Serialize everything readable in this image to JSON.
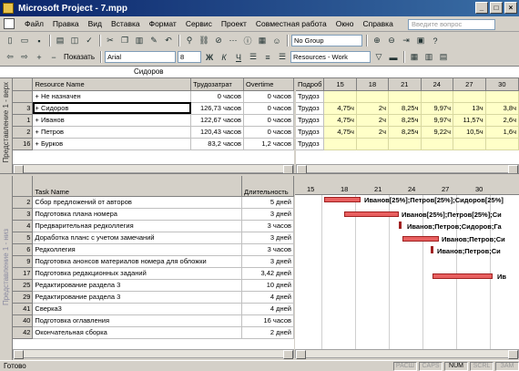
{
  "window": {
    "title": "Microsoft Project - 7.mpp"
  },
  "menu": [
    "Файл",
    "Правка",
    "Вид",
    "Вставка",
    "Формат",
    "Сервис",
    "Проект",
    "Совместная работа",
    "Окно",
    "Справка"
  ],
  "help_placeholder": "Введите вопрос",
  "toolbar": {
    "group": "No Group",
    "show": "Показать",
    "font": "Arial",
    "font_size": "8",
    "bold": "Ж",
    "italic": "К",
    "underline": "Ч",
    "filter": "Resources - Work"
  },
  "entry_bar": {
    "value": "Сидоров"
  },
  "top_view": {
    "side_label": "Представление 1 - верх",
    "columns": [
      "Resource Name",
      "Трудозатрат",
      "Overtime"
    ],
    "rows": [
      {
        "id": "",
        "name": "Не назначен",
        "work": "0 часов",
        "ot": "0 часов"
      },
      {
        "id": "3",
        "name": "Сидоров",
        "work": "126,73 часов",
        "ot": "0 часов"
      },
      {
        "id": "1",
        "name": "Иванов",
        "work": "122,67 часов",
        "ot": "0 часов"
      },
      {
        "id": "2",
        "name": "Петров",
        "work": "120,43 часов",
        "ot": "0 часов"
      },
      {
        "id": "16",
        "name": "Бурков",
        "work": "83,2 часов",
        "ot": "1,2 часов"
      }
    ]
  },
  "timescale": {
    "detail_header": "Подроб",
    "dates": [
      "15",
      "18",
      "21",
      "24",
      "27",
      "30"
    ],
    "label": "Трудоз",
    "rows": [
      [
        "",
        "",
        "",
        "",
        "",
        ""
      ],
      [
        "4,75ч",
        "2ч",
        "8,25ч",
        "9,97ч",
        "13ч",
        "3,8ч"
      ],
      [
        "4,75ч",
        "2ч",
        "8,25ч",
        "9,97ч",
        "11,57ч",
        "2,6ч"
      ],
      [
        "4,75ч",
        "2ч",
        "8,25ч",
        "9,22ч",
        "10,5ч",
        "1,6ч"
      ],
      [
        "",
        "",
        "",
        "",
        "",
        ""
      ]
    ]
  },
  "bottom_view": {
    "side_label": "Представление 1 - низ",
    "columns": [
      "Task Name",
      "Длительность"
    ],
    "rows": [
      {
        "id": "2",
        "name": "Сбор предложений от авторов",
        "dur": "5 дней"
      },
      {
        "id": "3",
        "name": "Подготовка плана номера",
        "dur": "3 дней"
      },
      {
        "id": "4",
        "name": "Предварительная редколлегия",
        "dur": "3 часов"
      },
      {
        "id": "5",
        "name": "Доработка планс с учетом замечаний",
        "dur": "3 дней"
      },
      {
        "id": "6",
        "name": "Редколлегия",
        "dur": "3 часов"
      },
      {
        "id": "9",
        "name": "Подготовка анонсов материалов номера для обложки",
        "dur": "3 дней"
      },
      {
        "id": "17",
        "name": "Подготовка редакционных заданий",
        "dur": "3,42 дней"
      },
      {
        "id": "25",
        "name": "Редактирование раздела 3",
        "dur": "10 дней"
      },
      {
        "id": "29",
        "name": "Редактирование раздела 3",
        "dur": "4 дней"
      },
      {
        "id": "41",
        "name": "Сверка3",
        "dur": "4 дней"
      },
      {
        "id": "40",
        "name": "Подготовка оглавления",
        "dur": "16 часов"
      },
      {
        "id": "42",
        "name": "Окончательная сборка",
        "dur": "2 дней"
      }
    ]
  },
  "gantt": {
    "dates": [
      "15",
      "18",
      "21",
      "24",
      "27",
      "30"
    ],
    "labels": [
      "Иванов[25%];Петров[25%];Сидоров[25%]",
      "Иванов[25%];Петров[25%];Си",
      "Иванов;Петров;Сидоров;Га",
      "Иванов;Петров;Си",
      "Иванов;Петров;Си",
      "Ив"
    ]
  },
  "status": {
    "text": "Готово",
    "indicators": [
      "РАСШ",
      "CAPS",
      "NUM",
      "SCRL",
      "ЗАМ"
    ],
    "active": "NUM"
  }
}
